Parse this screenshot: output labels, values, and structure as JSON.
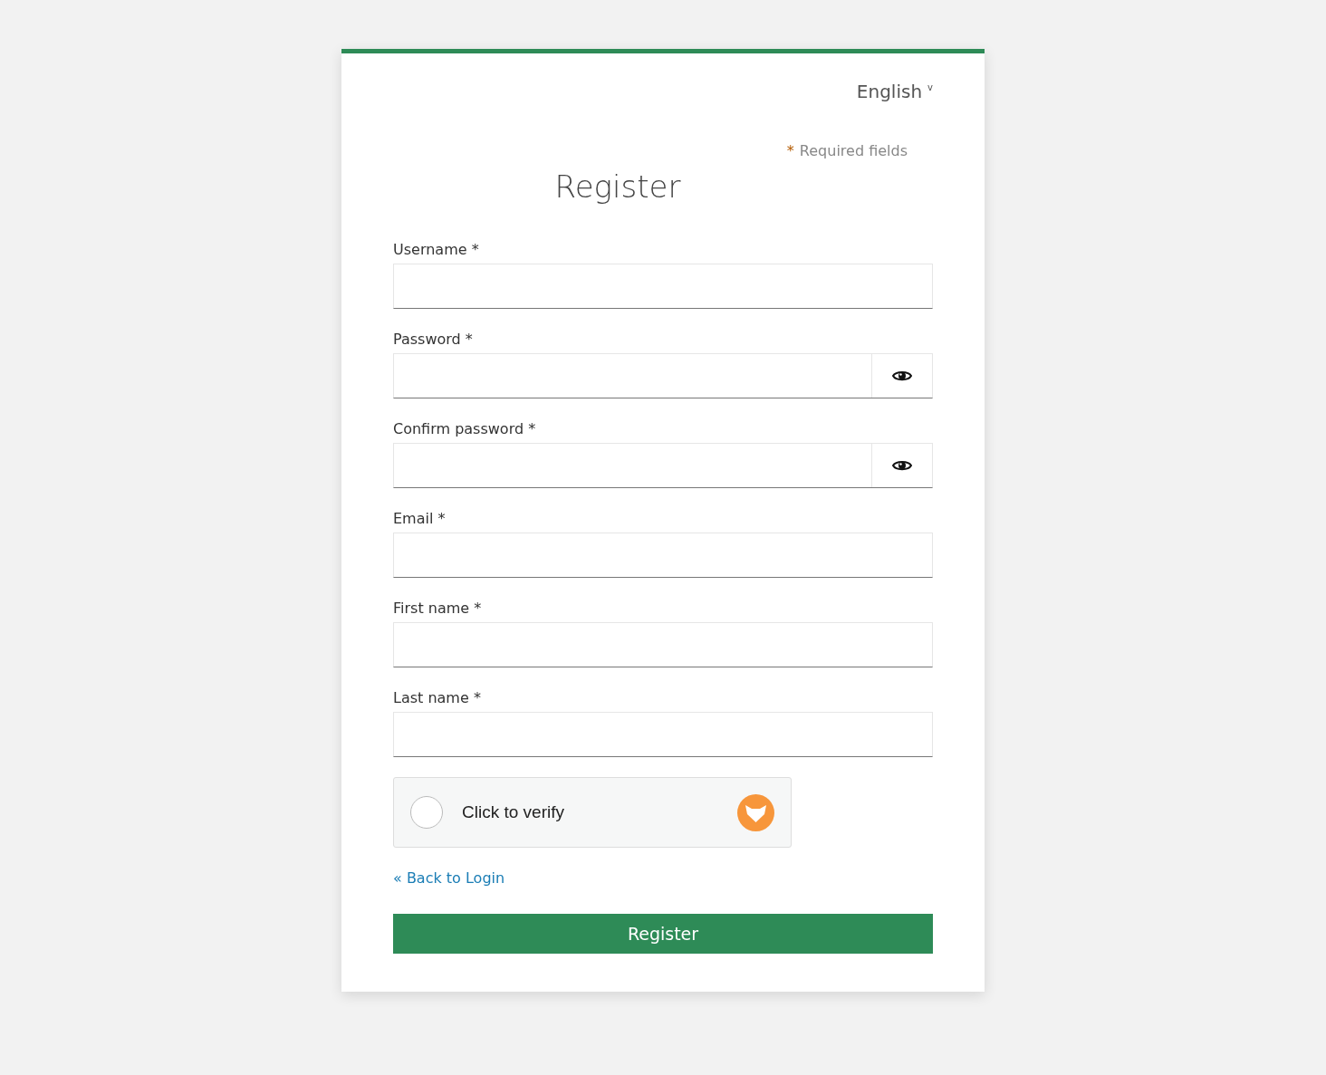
{
  "language": {
    "label": "English",
    "caret": "v"
  },
  "required_note": {
    "mark": "*",
    "text": "Required fields"
  },
  "title": "Register",
  "fields": [
    {
      "label": "Username *",
      "kind": "text"
    },
    {
      "label": "Password *",
      "kind": "password"
    },
    {
      "label": "Confirm password *",
      "kind": "password"
    },
    {
      "label": "Email *",
      "kind": "text"
    },
    {
      "label": "First name *",
      "kind": "text"
    },
    {
      "label": "Last name *",
      "kind": "text"
    }
  ],
  "captcha": {
    "label": "Click to verify",
    "checked": false
  },
  "back_link": "« Back to Login",
  "submit": "Register"
}
